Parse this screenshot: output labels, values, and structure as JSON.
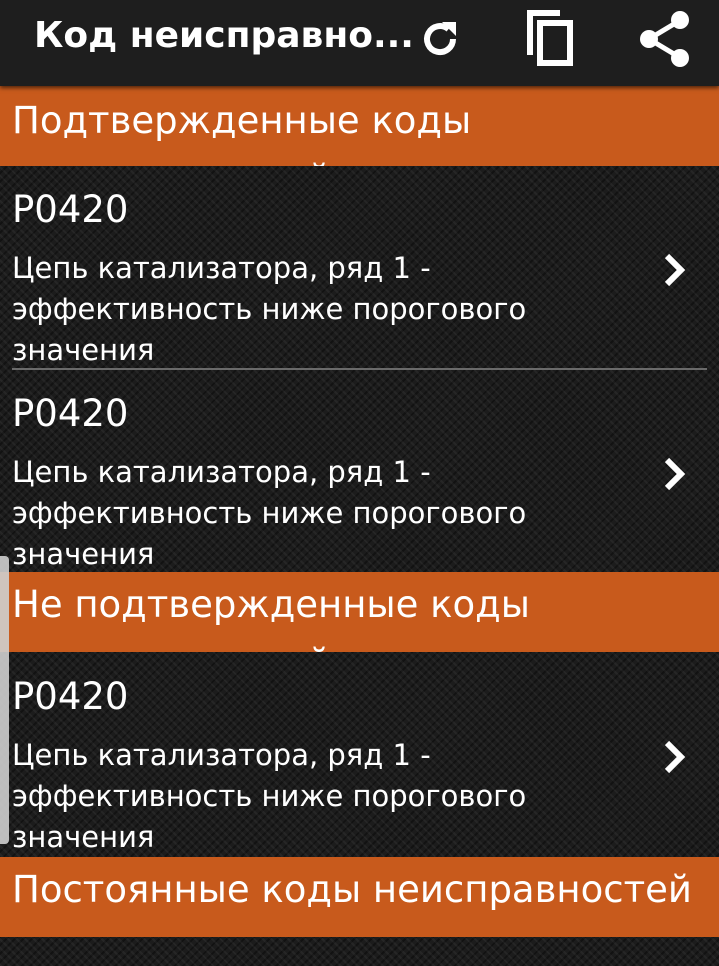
{
  "appbar": {
    "title": "Код неисправно...",
    "icons": [
      "refresh-icon",
      "copy-icon",
      "share-icon"
    ]
  },
  "sections": [
    {
      "header": "Подтвержденные коды неисправностей",
      "items": [
        {
          "code": "P0420",
          "description": "Цепь катализатора, ряд 1 - эффективность ниже порогового значения"
        },
        {
          "code": "P0420",
          "description": "Цепь катализатора, ряд 1 - эффективность ниже порогового значения"
        }
      ]
    },
    {
      "header": "Не подтвержденные коды неисправностей",
      "items": [
        {
          "code": "P0420",
          "description": "Цепь катализатора, ряд 1 - эффективность ниже порогового значения"
        }
      ]
    },
    {
      "header": "Постоянные коды неисправностей",
      "items": []
    }
  ],
  "colors": {
    "accent": "#c85a1c",
    "appbar": "#1e1e1e",
    "background": "#1c1c1c",
    "text": "#ffffff"
  }
}
